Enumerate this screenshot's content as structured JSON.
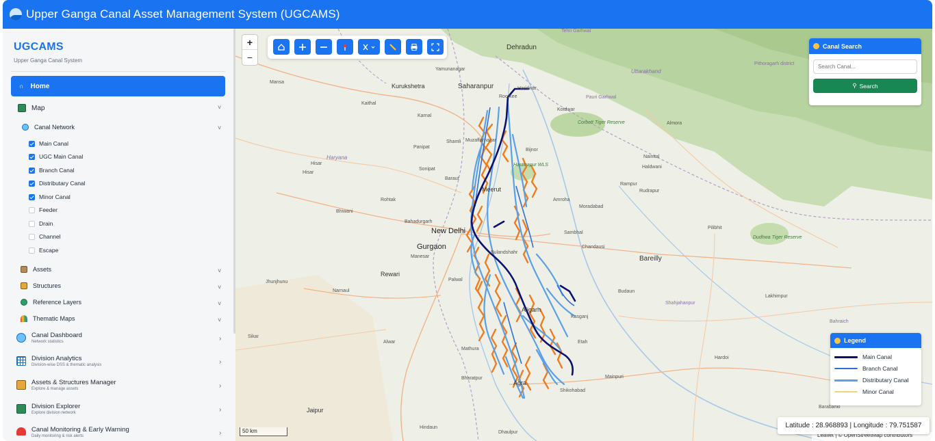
{
  "header": {
    "title": "Upper Ganga Canal Asset Management System (UGCAMS)"
  },
  "sidebar": {
    "brand": "UGCAMS",
    "tagline": "Upper Ganga Canal System",
    "home": "Home",
    "map": "Map",
    "canal_network": "Canal Network",
    "layers": [
      {
        "label": "Main Canal",
        "checked": true
      },
      {
        "label": "UGC Main Canal",
        "checked": true
      },
      {
        "label": "Branch Canal",
        "checked": true
      },
      {
        "label": "Distributary Canal",
        "checked": true
      },
      {
        "label": "Minor Canal",
        "checked": true
      },
      {
        "label": "Feeder",
        "checked": false
      },
      {
        "label": "Drain",
        "checked": false
      },
      {
        "label": "Channel",
        "checked": false
      },
      {
        "label": "Escape",
        "checked": false
      }
    ],
    "groups": [
      "Assets",
      "Structures",
      "Reference Layers",
      "Thematic Maps"
    ],
    "modules": [
      {
        "title": "Canal Dashboard",
        "sub": "Network statistics"
      },
      {
        "title": "Division Analytics",
        "sub": "Division-wise DSS & thematic analysis"
      },
      {
        "title": "Assets & Structures Manager",
        "sub": "Explore & manage assets"
      },
      {
        "title": "Division Explorer",
        "sub": "Explore division network"
      },
      {
        "title": "Canal Monitoring & Early Warning",
        "sub": "Daily monitoring & risk alerts"
      }
    ]
  },
  "map": {
    "zoom_in": "+",
    "zoom_out": "−",
    "scale": "50 km",
    "coords": "Latitude : 28.968893 | Longitude : 79.751587",
    "attribution": "Leaflet | © OpenStreetMap contributors",
    "search": {
      "title": "Canal Search",
      "placeholder": "Search Canal...",
      "button": "Search"
    },
    "legend": {
      "title": "Legend",
      "items": [
        {
          "label": "Main Canal",
          "color": "#0a1172"
        },
        {
          "label": "Branch Canal",
          "color": "#2f6fd6"
        },
        {
          "label": "Distributary Canal",
          "color": "#5aa0e8"
        },
        {
          "label": "Minor Canal",
          "color": "#f3d27a"
        }
      ]
    },
    "places": {
      "dehradun": "Dehradun",
      "saharanpur": "Saharanpur",
      "roorkee": "Roorkee",
      "haridwar": "Haridwar",
      "kurukshetra": "Kurukshetra",
      "muzaffarnagar": "Muzaffarnagar",
      "meerut": "Meerut",
      "new_delhi": "New Delhi",
      "gurgaon": "Gurgaon",
      "rewari": "Rewari",
      "bulandshahr": "Bulandshahr",
      "aligarh": "Aligarh",
      "mathura": "Mathura",
      "agra": "Agra",
      "bareilly": "Bareilly",
      "moradabad": "Moradabad",
      "rampur": "Rampur",
      "budaun": "Budaun",
      "kasganj": "Kasganj",
      "etah": "Etah",
      "jaipur": "Jaipur",
      "haldwani": "Haldwani",
      "almora": "Almora",
      "kotdwar": "Kotdwar",
      "bijnor": "Bijnor",
      "amroha": "Amroha",
      "sambhal": "Sambhal",
      "chandausi": "Chandausi",
      "pilibhit": "Pilibhit",
      "rudrapur": "Rudrapur",
      "shahjahanpur": "Shahjahanpur",
      "hardoi": "Hardoi",
      "lakhimpur": "Lakhimpur",
      "mainpuri": "Mainpuri",
      "shikohabad": "Shikohabad",
      "bharatpur": "Bharatpur",
      "alwar": "Alwar",
      "panipat": "Panipat",
      "sonipat": "Sonipat",
      "rohtak": "Rohtak",
      "bhiwani": "Bhiwani",
      "hisar": "Hisar",
      "karnal": "Karnal",
      "kaithal": "Kaithal",
      "yamunanagar": "Yamunanagar",
      "shamli": "Shamli",
      "baraut": "Baraut",
      "bahadurgarh": "Bahadurgarh",
      "manesar": "Manesar",
      "palwal": "Palwal",
      "narnaul": "Narnaul",
      "jhunjhunu": "Jhunjhunu",
      "sikar": "Sikar",
      "hindaun": "Hindaun",
      "dhaulpur": "Dhaulpur",
      "mansa": "Mansa",
      "haryana": "Haryana",
      "uttarakhand": "Uttarakhand",
      "corbett": "Corbett Tiger Reserve",
      "hastinapur": "Hastinapur WLS",
      "dudhwa": "Dudhwa Tiger Reserve",
      "tehri": "Tehri Garhwal",
      "pauri": "Pauri Garhwal",
      "nainital": "Nainital",
      "pithoragarh": "Pithoragarh district",
      "bahraich": "Bahraich",
      "barabanki": "Barabanki"
    }
  }
}
